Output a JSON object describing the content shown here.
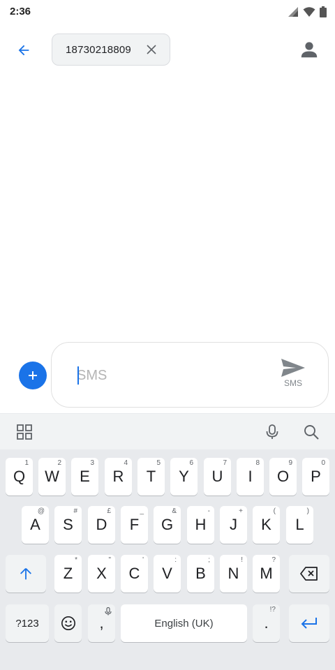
{
  "status": {
    "time": "2:36"
  },
  "recipient": {
    "number": "18730218809"
  },
  "compose": {
    "placeholder": "SMS",
    "send_label": "SMS"
  },
  "keyboard": {
    "row1": [
      {
        "label": "Q",
        "hint": "1"
      },
      {
        "label": "W",
        "hint": "2"
      },
      {
        "label": "E",
        "hint": "3"
      },
      {
        "label": "R",
        "hint": "4"
      },
      {
        "label": "T",
        "hint": "5"
      },
      {
        "label": "Y",
        "hint": "6"
      },
      {
        "label": "U",
        "hint": "7"
      },
      {
        "label": "I",
        "hint": "8"
      },
      {
        "label": "O",
        "hint": "9"
      },
      {
        "label": "P",
        "hint": "0"
      }
    ],
    "row2": [
      {
        "label": "A",
        "hint": "@"
      },
      {
        "label": "S",
        "hint": "#"
      },
      {
        "label": "D",
        "hint": "£"
      },
      {
        "label": "F",
        "hint": "_"
      },
      {
        "label": "G",
        "hint": "&"
      },
      {
        "label": "H",
        "hint": "-"
      },
      {
        "label": "J",
        "hint": "+"
      },
      {
        "label": "K",
        "hint": "("
      },
      {
        "label": "L",
        "hint": ")"
      }
    ],
    "row3": [
      {
        "label": "Z",
        "hint": "*"
      },
      {
        "label": "X",
        "hint": "\""
      },
      {
        "label": "C",
        "hint": "'"
      },
      {
        "label": "V",
        "hint": ":"
      },
      {
        "label": "B",
        "hint": ";"
      },
      {
        "label": "N",
        "hint": "!"
      },
      {
        "label": "M",
        "hint": "?"
      }
    ],
    "symbols_label": "?123",
    "comma_label": ",",
    "space_label": "English (UK)",
    "period_label": ".",
    "period_hint": "!?"
  },
  "colors": {
    "accent": "#1a73e8",
    "keyboard_bg": "#e8eaed"
  }
}
